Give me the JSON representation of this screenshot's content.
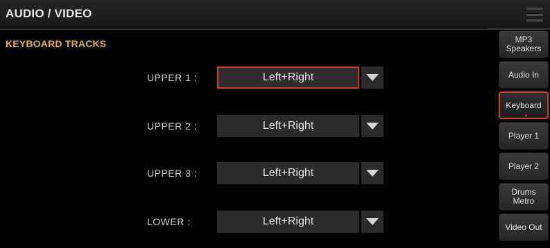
{
  "header": {
    "title": "AUDIO / VIDEO",
    "menu_icon": "hamburger-menu-icon"
  },
  "section": {
    "title": "KEYBOARD TRACKS"
  },
  "tracks": [
    {
      "label": "UPPER 1 :",
      "value": "Left+Right",
      "selected": true
    },
    {
      "label": "UPPER 2 :",
      "value": "Left+Right",
      "selected": false
    },
    {
      "label": "UPPER 3 :",
      "value": "Left+Right",
      "selected": false
    },
    {
      "label": "LOWER :",
      "value": "Left+Right",
      "selected": false
    }
  ],
  "tabs": [
    {
      "label": "MP3\nSpeakers",
      "active": false
    },
    {
      "label": "Audio In",
      "active": false
    },
    {
      "label": "Keyboard",
      "active": true
    },
    {
      "label": "Player 1",
      "active": false
    },
    {
      "label": "Player 2",
      "active": false
    },
    {
      "label": "Drums\nMetro",
      "active": false
    },
    {
      "label": "Video Out",
      "active": false
    }
  ],
  "colors": {
    "accent_orange": "#e8b24a",
    "selection_red": "#d83a2a",
    "field_bg": "#2b2b2b"
  }
}
